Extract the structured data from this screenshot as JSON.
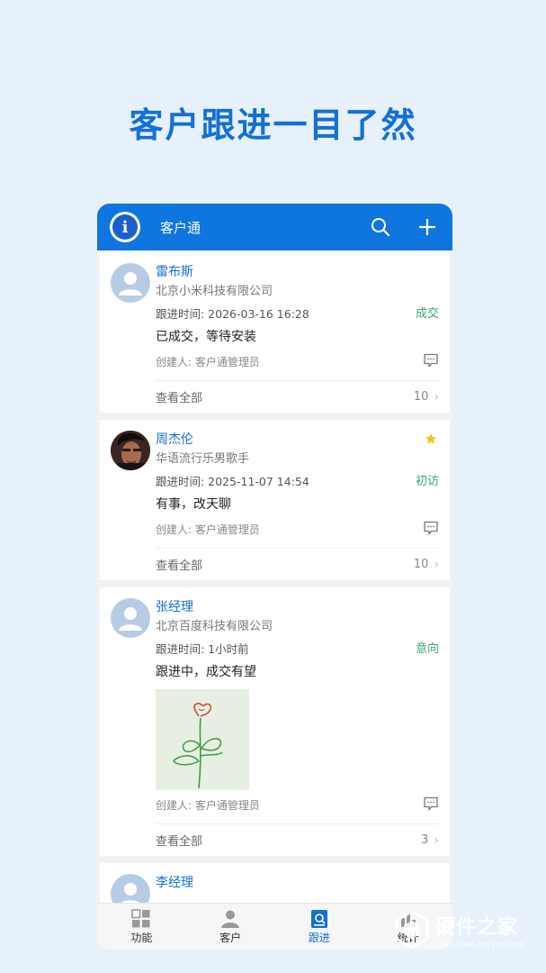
{
  "headline": "客户跟进一目了然",
  "app": {
    "title": "客户通",
    "logo_letter": "i",
    "accent_color": "#0e76de"
  },
  "entries": [
    {
      "name": "雷布斯",
      "subtitle": "北京小米科技有限公司",
      "time": "跟进时间: 2026-03-16 16:28",
      "stage": "成交",
      "content": "已成交，等待安装",
      "creator": "创建人: 客户通管理员",
      "view_all": "查看全部",
      "count": "10",
      "starred": false
    },
    {
      "name": "周杰伦",
      "subtitle": "华语流行乐男歌手",
      "time": "跟进时间: 2025-11-07 14:54",
      "stage": "初访",
      "content": "有事，改天聊",
      "creator": "创建人: 客户通管理员",
      "view_all": "查看全部",
      "count": "10",
      "starred": true
    },
    {
      "name": "张经理",
      "subtitle": "北京百度科技有限公司",
      "time": "跟进时间: 1小时前",
      "stage": "意向",
      "content": "跟进中，成交有望",
      "creator": "创建人: 客户通管理员",
      "view_all": "查看全部",
      "count": "3",
      "starred": false
    },
    {
      "name": "李经理"
    }
  ],
  "tabs": [
    {
      "label": "功能",
      "icon": "grid-icon"
    },
    {
      "label": "客户",
      "icon": "person-icon"
    },
    {
      "label": "跟进",
      "icon": "followup-icon",
      "active": true
    },
    {
      "label": "统计",
      "icon": "stats-icon"
    }
  ],
  "watermark": {
    "cn": "硬件之家",
    "en": "YING JIAN ZHI JIA.COM"
  }
}
